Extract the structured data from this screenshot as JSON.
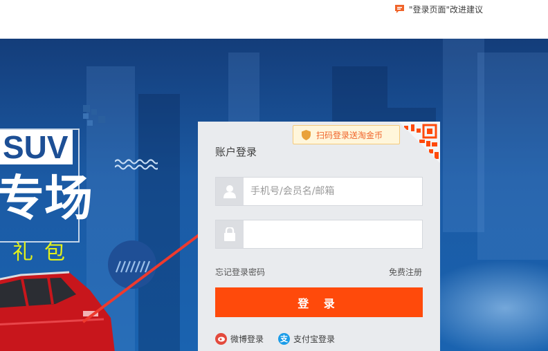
{
  "header": {
    "feedback_text": "\"登录页面\"改进建议",
    "feedback_icon": "chat-bubble-icon"
  },
  "banner": {
    "promo_suv": "SUV",
    "promo_big": "专场",
    "promo_gift": "礼包"
  },
  "login": {
    "qr_tip": "扫码登录送淘金币",
    "title": "账户登录",
    "username_placeholder": "手机号/会员名/邮箱",
    "forgot_password": "忘记登录密码",
    "register": "免费注册",
    "submit": "登 录",
    "weibo_login": "微博登录",
    "alipay_login": "支付宝登录",
    "alipay_glyph": "支"
  },
  "colors": {
    "accent": "#ff4a0b",
    "tip_text": "#f0642a",
    "annotation_arrow": "#ee3a2e"
  }
}
